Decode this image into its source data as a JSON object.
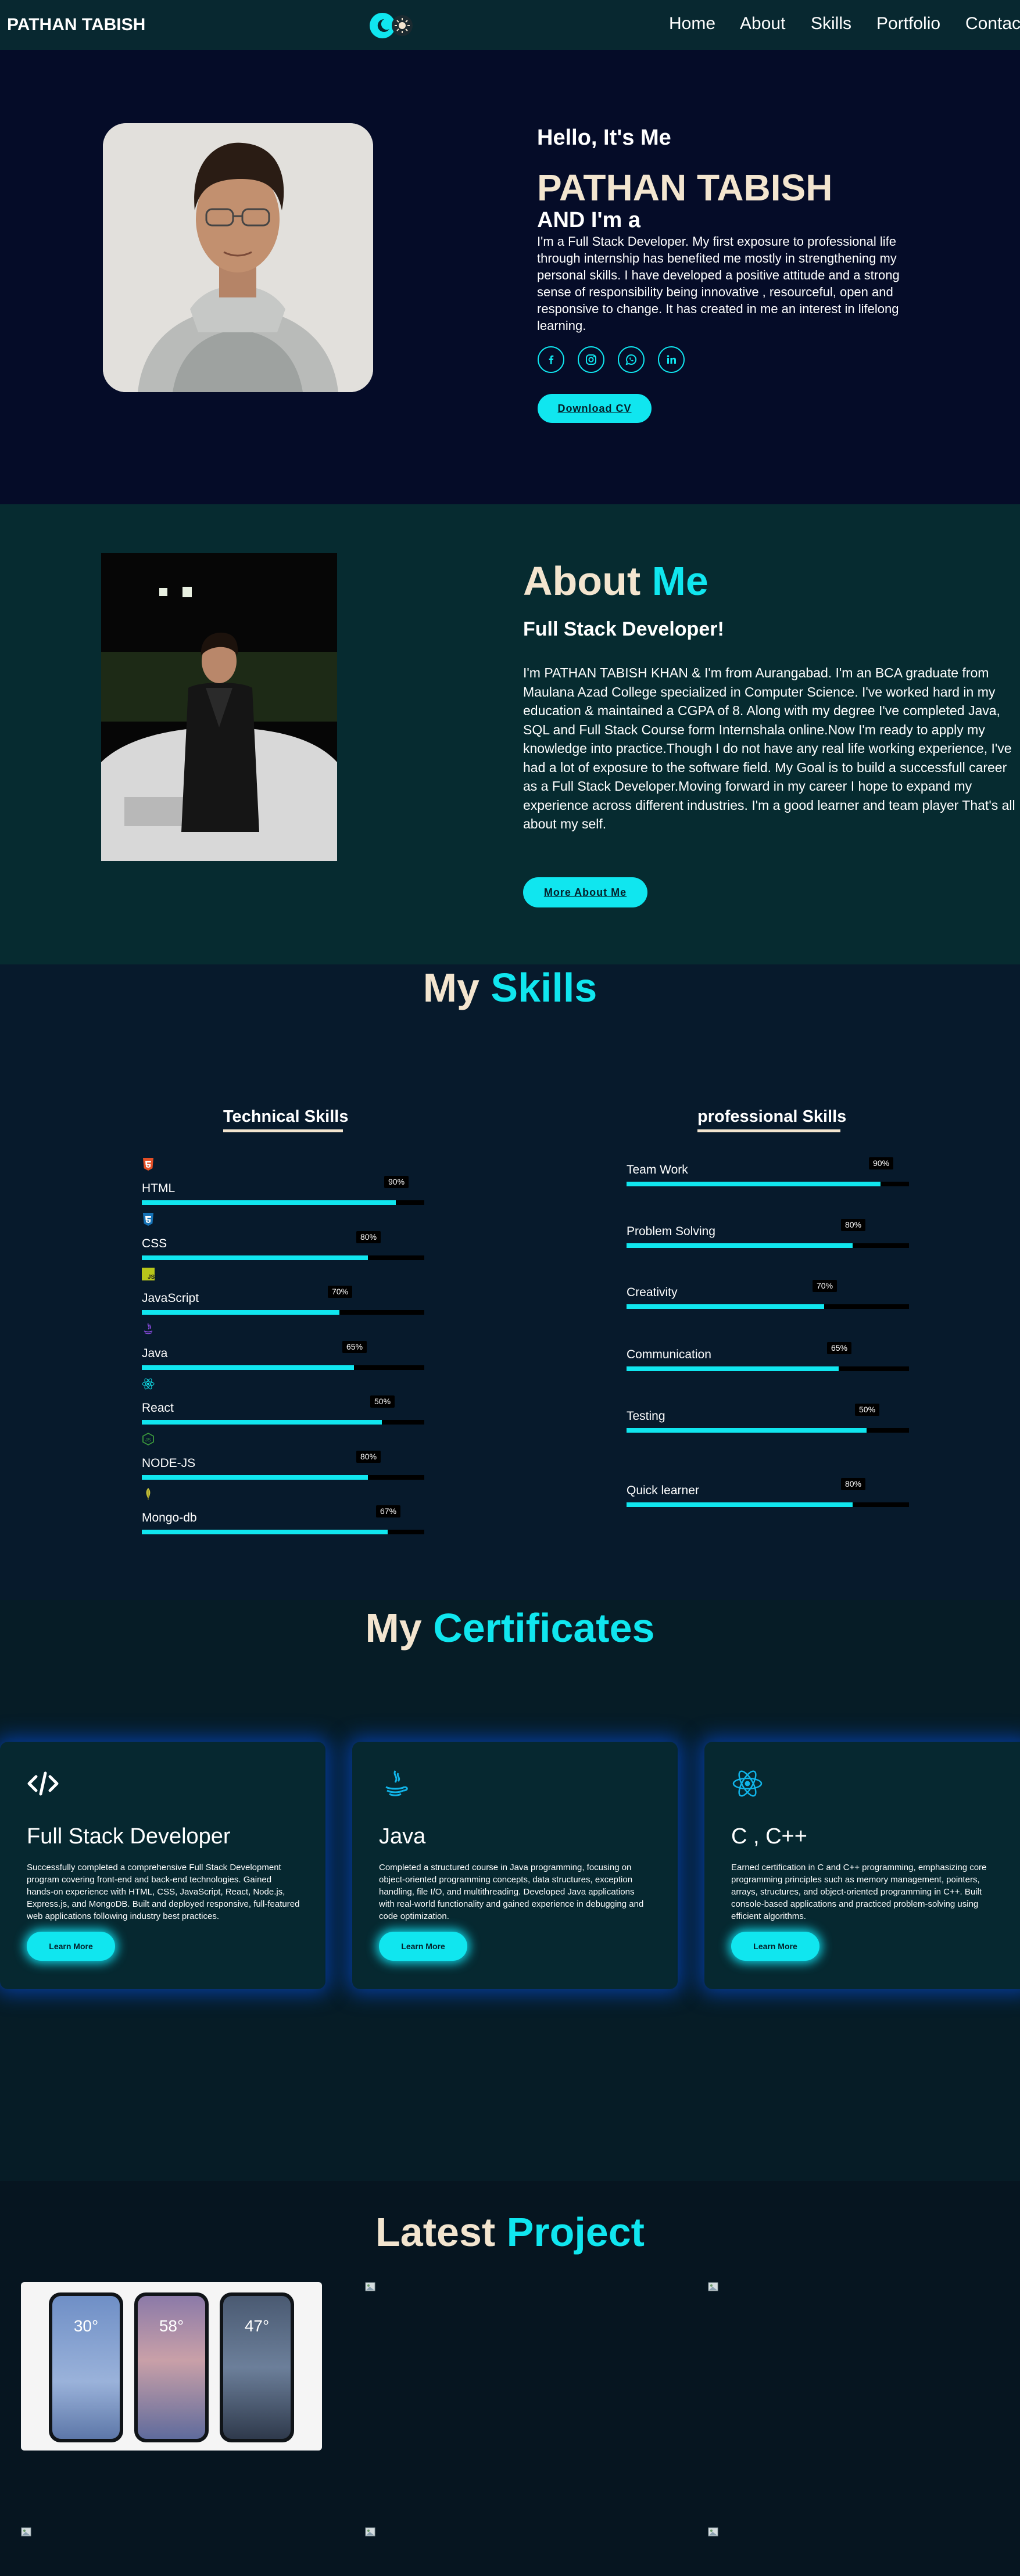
{
  "nav": {
    "brand": "PATHAN TABISH",
    "links": [
      "Home",
      "About",
      "Skills",
      "Portfolio",
      "Contact"
    ]
  },
  "hero": {
    "greeting": "Hello, It's Me",
    "name": "PATHAN TABISH",
    "role_prefix": "AND I'm a",
    "text": "I'm a Full Stack Developer. My first exposure to professional life through internship has benefited me mostly in strengthening my personal skills. I have developed a positive attitude and a strong sense of responsibility being innovative , resourceful, open and responsive to change. It has created in me an interest in lifelong learning.",
    "social": [
      "facebook-icon",
      "instagram-icon",
      "whatsapp-icon",
      "linkedin-icon"
    ],
    "download_label": "Download CV"
  },
  "about": {
    "title_a": "About ",
    "title_b": "Me",
    "subtitle": "Full Stack Developer!",
    "text": "I'm PATHAN TABISH KHAN & I'm from Aurangabad. I'm an BCA graduate from Maulana Azad College specialized in Computer Science. I've worked hard in my education & maintained a CGPA of 8. Along with my degree I've completed Java, SQL and Full Stack Course form Internshala online.Now I'm ready to apply my knowledge into practice.Though I do not have any real life working experience, I've had a lot of exposure to the software field. My Goal is to build a successfull career as a Full Stack Developer.Moving forward in my career I hope to expand my experience across different industries. I'm a good learner and team player That's all about my self.",
    "button_label": "More About Me"
  },
  "skills": {
    "title_a": "My ",
    "title_b": "Skills",
    "technical_title": "Technical Skills",
    "professional_title": "professional Skills",
    "technical": [
      {
        "name": "HTML",
        "percent_label": "90%",
        "fill": 0.9,
        "icon": "html5-icon"
      },
      {
        "name": "CSS",
        "percent_label": "80%",
        "fill": 0.8,
        "icon": "css3-icon"
      },
      {
        "name": "JavaScript",
        "percent_label": "70%",
        "fill": 0.7,
        "icon": "javascript-icon"
      },
      {
        "name": "Java",
        "percent_label": "65%",
        "fill": 0.75,
        "icon": "java-icon"
      },
      {
        "name": "React",
        "percent_label": "50%",
        "fill": 0.85,
        "icon": "react-icon"
      },
      {
        "name": "NODE-JS",
        "percent_label": "80%",
        "fill": 0.8,
        "icon": "nodejs-icon"
      },
      {
        "name": "Mongo-db",
        "percent_label": "67%",
        "fill": 0.87,
        "icon": "mongodb-icon"
      }
    ],
    "professional": [
      {
        "name": "Team Work",
        "percent_label": "90%",
        "fill": 0.9
      },
      {
        "name": "Problem Solving",
        "percent_label": "80%",
        "fill": 0.8
      },
      {
        "name": "Creativity",
        "percent_label": "70%",
        "fill": 0.7
      },
      {
        "name": "Communication",
        "percent_label": "65%",
        "fill": 0.75
      },
      {
        "name": "Testing",
        "percent_label": "50%",
        "fill": 0.85
      },
      {
        "name": "Quick learner",
        "percent_label": "80%",
        "fill": 0.8
      }
    ]
  },
  "certificates": {
    "title_a": "My ",
    "title_b": "Certificates",
    "cards": [
      {
        "title": "Full Stack Developer",
        "icon": "code-icon",
        "text": "Successfully completed a comprehensive Full Stack Development program covering front-end and back-end technologies. Gained hands-on experience with HTML, CSS, JavaScript, React, Node.js, Express.js, and MongoDB. Built and deployed responsive, full-featured web applications following industry best practices.",
        "button": "Learn More"
      },
      {
        "title": "Java",
        "icon": "java-icon",
        "text": "Completed a structured course in Java programming, focusing on object-oriented programming concepts, data structures, exception handling, file I/O, and multithreading. Developed Java applications with real-world functionality and gained experience in debugging and code optimization.",
        "button": "Learn More"
      },
      {
        "title": "C , C++",
        "icon": "react-icon",
        "text": "Earned certification in C and C++ programming, emphasizing core programming principles such as memory management, pointers, arrays, structures, and object-oriented programming in C++. Built console-based applications and practiced problem-solving using efficient algorithms.",
        "button": "Learn More"
      }
    ]
  },
  "projects": {
    "title_a": "Latest ",
    "title_b": "Project",
    "phones": [
      "30°",
      "58°",
      "47°"
    ]
  },
  "colors": {
    "accent": "#10e6ef",
    "cream": "#f3e5cf"
  }
}
